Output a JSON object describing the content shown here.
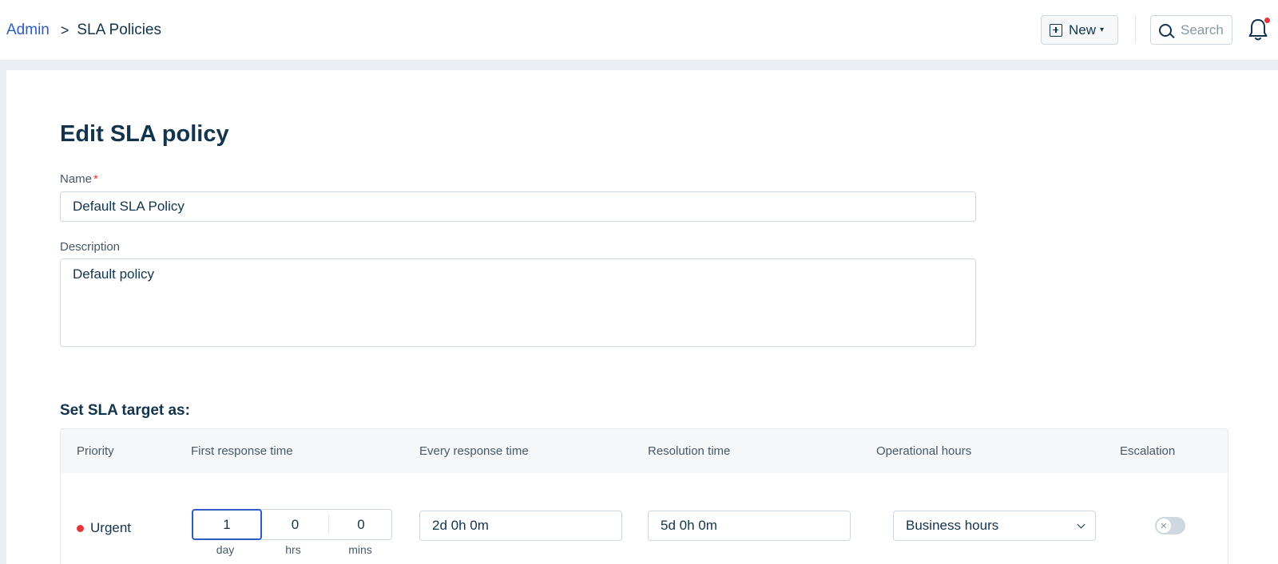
{
  "breadcrumb": {
    "parent": "Admin",
    "separator": ">",
    "current": "SLA Policies"
  },
  "header": {
    "new_label": "New",
    "search_placeholder": "Search"
  },
  "page": {
    "title": "Edit SLA policy"
  },
  "form": {
    "name_label": "Name",
    "name_required": "*",
    "name_value": "Default SLA Policy",
    "description_label": "Description",
    "description_value": "Default policy"
  },
  "sla": {
    "section_title": "Set SLA target as:",
    "columns": [
      "Priority",
      "First response time",
      "Every response time",
      "Resolution time",
      "Operational hours",
      "Escalation"
    ],
    "rows": [
      {
        "priority": "Urgent",
        "priority_color": "#e43538",
        "first_response": {
          "day": "1",
          "hrs": "0",
          "mins": "0",
          "day_unit": "day",
          "hrs_unit": "hrs",
          "mins_unit": "mins"
        },
        "every_response": "2d 0h 0m",
        "resolution": "5d 0h 0m",
        "operational_hours": "Business hours",
        "escalation": "off"
      }
    ]
  },
  "colors": {
    "accent": "#2c5cc5",
    "text": "#12344d",
    "required": "#e43538"
  }
}
